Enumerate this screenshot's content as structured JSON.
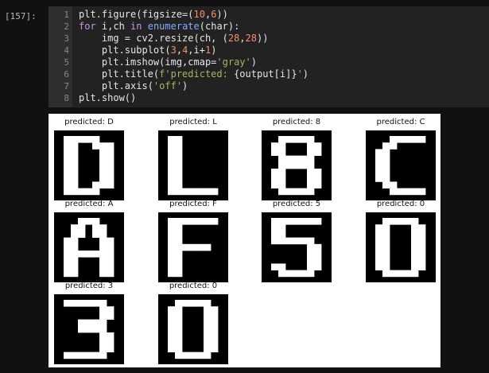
{
  "cell_prompt": "[157]:",
  "code_lines": [
    {
      "num": "1",
      "parts": [
        {
          "t": "plt.figure(figsize=(",
          "c": ""
        },
        {
          "t": "10",
          "c": "num"
        },
        {
          "t": ",",
          "c": ""
        },
        {
          "t": "6",
          "c": "num"
        },
        {
          "t": "))",
          "c": ""
        }
      ]
    },
    {
      "num": "2",
      "parts": [
        {
          "t": "for",
          "c": "kw"
        },
        {
          "t": " i,ch ",
          "c": ""
        },
        {
          "t": "in",
          "c": "kw"
        },
        {
          "t": " ",
          "c": ""
        },
        {
          "t": "enumerate",
          "c": "fn"
        },
        {
          "t": "(char):",
          "c": ""
        }
      ]
    },
    {
      "num": "3",
      "parts": [
        {
          "t": "    img = cv2.resize(ch, (",
          "c": ""
        },
        {
          "t": "28",
          "c": "num"
        },
        {
          "t": ",",
          "c": ""
        },
        {
          "t": "28",
          "c": "num"
        },
        {
          "t": "))",
          "c": ""
        }
      ]
    },
    {
      "num": "4",
      "parts": [
        {
          "t": "    plt.subplot(",
          "c": ""
        },
        {
          "t": "3",
          "c": "num"
        },
        {
          "t": ",",
          "c": ""
        },
        {
          "t": "4",
          "c": "num"
        },
        {
          "t": ",i+",
          "c": ""
        },
        {
          "t": "1",
          "c": "num"
        },
        {
          "t": ")",
          "c": ""
        }
      ]
    },
    {
      "num": "5",
      "parts": [
        {
          "t": "    plt.imshow(img,cmap=",
          "c": ""
        },
        {
          "t": "'gray'",
          "c": "str"
        },
        {
          "t": ")",
          "c": ""
        }
      ]
    },
    {
      "num": "6",
      "parts": [
        {
          "t": "    plt.title(",
          "c": ""
        },
        {
          "t": "f'predicted: ",
          "c": "str"
        },
        {
          "t": "{output[i]}",
          "c": ""
        },
        {
          "t": "'",
          "c": "str"
        },
        {
          "t": ")",
          "c": ""
        }
      ]
    },
    {
      "num": "7",
      "parts": [
        {
          "t": "    plt.axis(",
          "c": ""
        },
        {
          "t": "'off'",
          "c": "str"
        },
        {
          "t": ")",
          "c": ""
        }
      ]
    },
    {
      "num": "8",
      "parts": [
        {
          "t": "plt.show()",
          "c": ""
        }
      ]
    }
  ],
  "predictions": [
    {
      "title": "predicted: D",
      "char": "D"
    },
    {
      "title": "predicted: L",
      "char": "L"
    },
    {
      "title": "predicted: 8",
      "char": "8"
    },
    {
      "title": "predicted: C",
      "char": "C"
    },
    {
      "title": "predicted: A",
      "char": "A"
    },
    {
      "title": "predicted: F",
      "char": "F"
    },
    {
      "title": "predicted: 5",
      "char": "5"
    },
    {
      "title": "predicted: 0",
      "char": "0"
    },
    {
      "title": "predicted: 3",
      "char": "3"
    },
    {
      "title": "predicted: 0",
      "char": "0"
    }
  ],
  "colors": {
    "image_background": "#000000",
    "glyph": "#ffffff"
  }
}
